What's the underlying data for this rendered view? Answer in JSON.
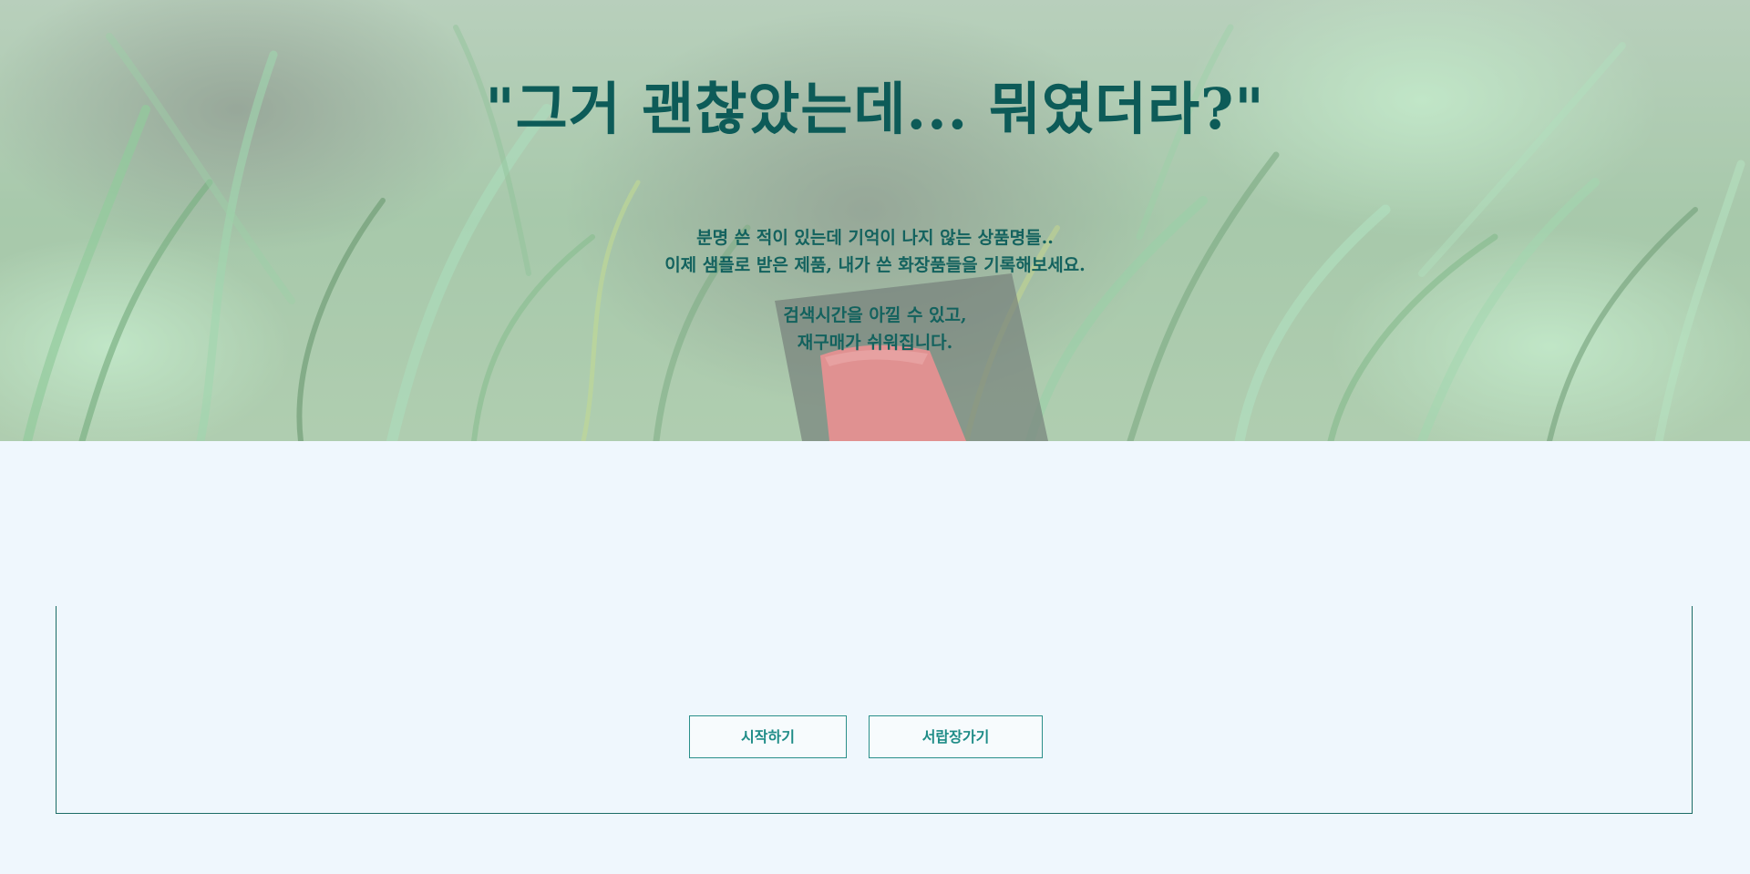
{
  "hero": {
    "title": "\"그거 괜찮았는데... 뭐였더라?\"",
    "lines": [
      "분명 쓴 적이 있는데 기억이 나지 않는 상품명들..",
      "이제 샘플로 받은 제품, 내가 쓴 화장품들을 기록해보세요.",
      "검색시간을 아낄 수 있고,",
      "재구매가 쉬워집니다."
    ]
  },
  "actions": {
    "start_label": "시작하기",
    "drawer_label": "서랍장가기"
  },
  "colors": {
    "accent": "#0d5b58",
    "button_text": "#1e8c87",
    "page_background": "#eff7fd"
  }
}
